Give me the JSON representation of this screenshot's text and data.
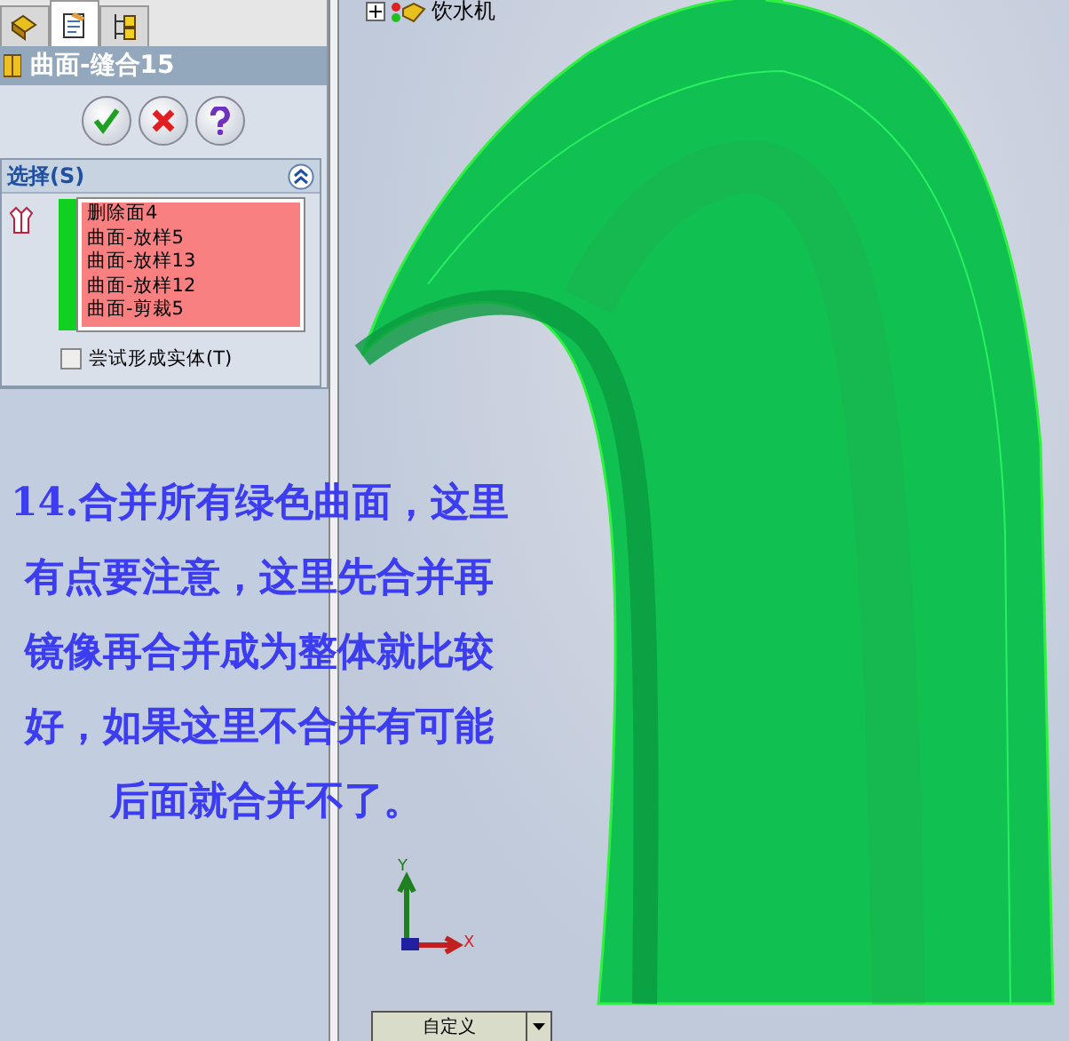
{
  "panel": {
    "tabs": [
      {
        "kind": "feature",
        "selected": false
      },
      {
        "kind": "property",
        "selected": true
      },
      {
        "kind": "config",
        "selected": false
      }
    ],
    "title": "曲面-缝合15",
    "section": {
      "title": "选择(S)",
      "expanded": true,
      "items": [
        "删除面4",
        "曲面-放样5",
        "曲面-放样13",
        "曲面-放样12",
        "曲面-剪裁5"
      ],
      "checkbox": {
        "label": "尝试形成实体(T)",
        "checked": false
      }
    }
  },
  "tree": {
    "label": "饮水机",
    "expanded": false
  },
  "annotation": [
    "14.合并所有绿色曲面，这里",
    "有点要注意，这里先合并再",
    "镜像再合并成为整体就比较",
    "好，如果这里不合并有可能",
    "后面就合并不了。"
  ],
  "triad": {
    "x": "X",
    "y": "Y"
  },
  "dropdown": {
    "value": "自定义"
  }
}
